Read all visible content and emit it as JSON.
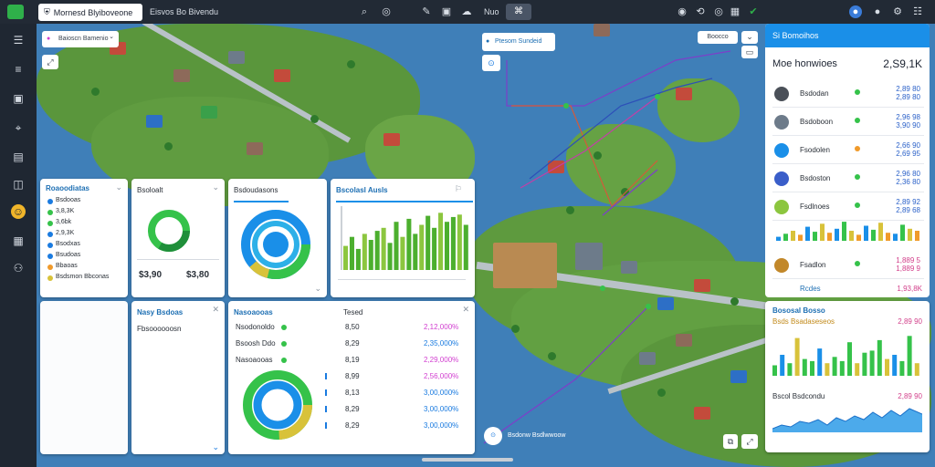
{
  "topbar": {
    "tab1_label": "Mornesd Blyiboveone",
    "tab2_label": "Eisvos Bo Bivendu",
    "tab3_label": "Nuo",
    "icons": [
      "search-icon",
      "gamepad-icon",
      "wand-icon",
      "image-icon",
      "cloud-icon",
      "camera-icon",
      "swap-icon",
      "globe-icon",
      "grid-icon",
      "check-icon",
      "bell-icon",
      "settings-icon"
    ]
  },
  "rail": {
    "icons": [
      "menu-icon",
      "list-icon",
      "image-icon",
      "pin-icon",
      "chart-icon",
      "layers-icon",
      "smile-icon",
      "grid-icon",
      "people-icon"
    ]
  },
  "filter": {
    "label": "Baioscn Bamenio",
    "chevron": "⌄"
  },
  "map_callout": {
    "label": "Ptesom Sundeid"
  },
  "map_buttons": {
    "btn1": "Boocco",
    "btn2": "⌄"
  },
  "right_panel": {
    "header_title": "Si Bomoihos",
    "subtitle": "Moe honwioes",
    "total": "2,S9,1K",
    "rows": [
      {
        "name": "Bsdodan",
        "val1": "2,89 80",
        "val2": "2,89 80",
        "color": "#35c24a"
      },
      {
        "name": "Bsdoboon",
        "val1": "2,96 98",
        "val2": "3,90 90",
        "color": "#35c24a"
      },
      {
        "name": "Fsodolen",
        "val1": "2,66 90",
        "val2": "2,69 95",
        "color": "#f09a2a"
      },
      {
        "name": "Bsdoston",
        "val1": "2,96 80",
        "val2": "2,36 80",
        "color": "#35c24a"
      },
      {
        "name": "Fsdlnoes",
        "val1": "2,89 92",
        "val2": "2,89 68",
        "color": "#35c24a"
      }
    ],
    "mini_chart": [
      0.2,
      0.35,
      0.5,
      0.3,
      0.7,
      0.45,
      0.85,
      0.4,
      0.6,
      0.95,
      0.5,
      0.3,
      0.75,
      0.55,
      0.9,
      0.4,
      0.35,
      0.8,
      0.6,
      0.5
    ],
    "last_row": {
      "name": "Fsadlon",
      "val1": "1,889 5",
      "val2": "1,889 9"
    },
    "footer_label": "Rcdes",
    "footer_value": "1,93,8K"
  },
  "panel_legend": {
    "title": "Roaoodiatas",
    "items": [
      {
        "label": "Bsdooas",
        "color": "#1a7be0"
      },
      {
        "label": "3,8,3K",
        "color": "#35c24a"
      },
      {
        "label": "3,6bk",
        "color": "#35c24a"
      },
      {
        "label": "2,9,3K",
        "color": "#1a7be0"
      },
      {
        "label": "Bsodxas",
        "color": "#1a7be0"
      },
      {
        "label": "Bsudoas",
        "color": "#1a7be0"
      },
      {
        "label": "Bbaoas",
        "color": "#f09a2a"
      },
      {
        "label": "Bsdsmon Bbconas",
        "color": "#d8c23a"
      }
    ]
  },
  "panel_donut1": {
    "title": "Bsoloalt",
    "val1": "$3,90",
    "val2": "$3,80"
  },
  "panel_donut2": {
    "title": "Bsdoudasons"
  },
  "panel_bars": {
    "title": "Bscolasl Ausls",
    "values": [
      0.4,
      0.55,
      0.35,
      0.6,
      0.5,
      0.65,
      0.7,
      0.45,
      0.8,
      0.55,
      0.85,
      0.6,
      0.75,
      0.9,
      0.7,
      0.95,
      0.8,
      0.88,
      0.92,
      0.75
    ]
  },
  "panel_small": {
    "title": "Nasy Bsdoas",
    "line": "Fbsoooooosn"
  },
  "panel_table": {
    "rows": [
      {
        "name": "Nsodonoldo",
        "mid": "8,50",
        "right": "2,12,000%",
        "rcolor": "#d23fd0"
      },
      {
        "name": "Bsoosh Ddo",
        "mid": "8,29",
        "right": "2,35,000%",
        "rcolor": "#1a7be0"
      },
      {
        "name": "Nasoaooas",
        "mid": "8,19",
        "right": "2,29,000%",
        "rcolor": "#d23fd0"
      },
      {
        "name": "",
        "mid": "8,99",
        "right": "2,56,000%",
        "rcolor": "#d23fd0"
      },
      {
        "name": "",
        "mid": "8,13",
        "right": "3,00,000%",
        "rcolor": "#1a7be0"
      },
      {
        "name": "",
        "mid": "8,29",
        "right": "3,00,000%",
        "rcolor": "#1a7be0"
      },
      {
        "name": "",
        "mid": "8,29",
        "right": "3,00,000%",
        "rcolor": "#1a7be0"
      }
    ],
    "header_mid": "Tesed",
    "close": "✕"
  },
  "panel_right_bottom": {
    "title": "Bososal Bosso",
    "subtitle": "Bsds Bsadaseseos",
    "value": "2,89 90",
    "bars": [
      0.25,
      0.5,
      0.3,
      0.9,
      0.4,
      0.35,
      0.65,
      0.3,
      0.45,
      0.35,
      0.8,
      0.3,
      0.55,
      0.6,
      0.85,
      0.4,
      0.5,
      0.35,
      0.95,
      0.3
    ],
    "line_label": "Bscol Bsdcondu",
    "line_value": "2,89 90"
  },
  "map_search": {
    "placeholder": "Bsdonw Bsdlwwoow"
  }
}
